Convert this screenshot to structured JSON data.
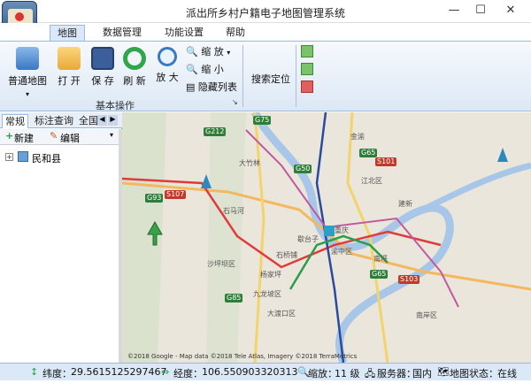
{
  "window": {
    "title": "派出所乡村户籍电子地图管理系统",
    "min_glyph": "—",
    "max_glyph": "☐",
    "close_glyph": "✕"
  },
  "menu": {
    "tabs": [
      {
        "label": "地图"
      },
      {
        "label": "数据管理"
      },
      {
        "label": "功能设置"
      },
      {
        "label": "帮助"
      }
    ]
  },
  "ribbon": {
    "buttons": {
      "basemap": "普通地图",
      "open": "打 开",
      "save": "保 存",
      "refresh": "刷 新",
      "zoomin": "放 大"
    },
    "small": {
      "scale": "缩 放",
      "zoomout": "缩 小",
      "hide_list": "隐藏列表"
    },
    "search_label": "搜索定位",
    "group_basic": "基本操作"
  },
  "left_panel": {
    "tabs": [
      "常规",
      "标注查询",
      "全国"
    ],
    "new_label": "新建",
    "edit_label": "编辑",
    "tree_root": "民和县",
    "expand_glyph": "+"
  },
  "map": {
    "labels": {
      "yunnan_hou": "大竹林",
      "dongcun": "大竹林",
      "jiangbei": "江北区",
      "shapingba": "沙坪坝区",
      "jiulongpo": "九龙坡区",
      "nanan": "南岸区",
      "dadukou": "大渡口区",
      "yubei": "渝中区",
      "banan": "区",
      "gaoxin": "石马河",
      "luojia": "歇台子",
      "chongqing": "重庆",
      "nanping": "南坪",
      "yangjiaping": "杨家坪",
      "jinyu": "金渝",
      "shiqiaopu": "石桥铺",
      "jianxin": "建新"
    },
    "highways": {
      "g75": "G75",
      "g212": "G212",
      "g50": "G50",
      "g65": "G65",
      "g85": "G85",
      "g93": "G93",
      "s107": "S107",
      "s101": "S101",
      "s103": "S103",
      "g65b": "G65"
    },
    "copyright": "©2018 Google - Map data ©2018 Tele Atlas, Imagery ©2018 TerraMetrics"
  },
  "status": {
    "lat_label": "纬度：",
    "lat_value": "29.5615125297467",
    "lon_label": "经度：",
    "lon_value": "106.550903320313",
    "zoom_label": "缩放：",
    "zoom_value": "11 级",
    "server_label": "服务器：",
    "server_value": "国内",
    "mapstate_label": "地图状态：",
    "mapstate_value": "在线"
  },
  "colors": {
    "accent": "#dbe8f7",
    "metro_red": "#e03b3b",
    "metro_blue": "#2a4aa0",
    "metro_green": "#2a9d4a",
    "metro_pink": "#c05aa0"
  }
}
